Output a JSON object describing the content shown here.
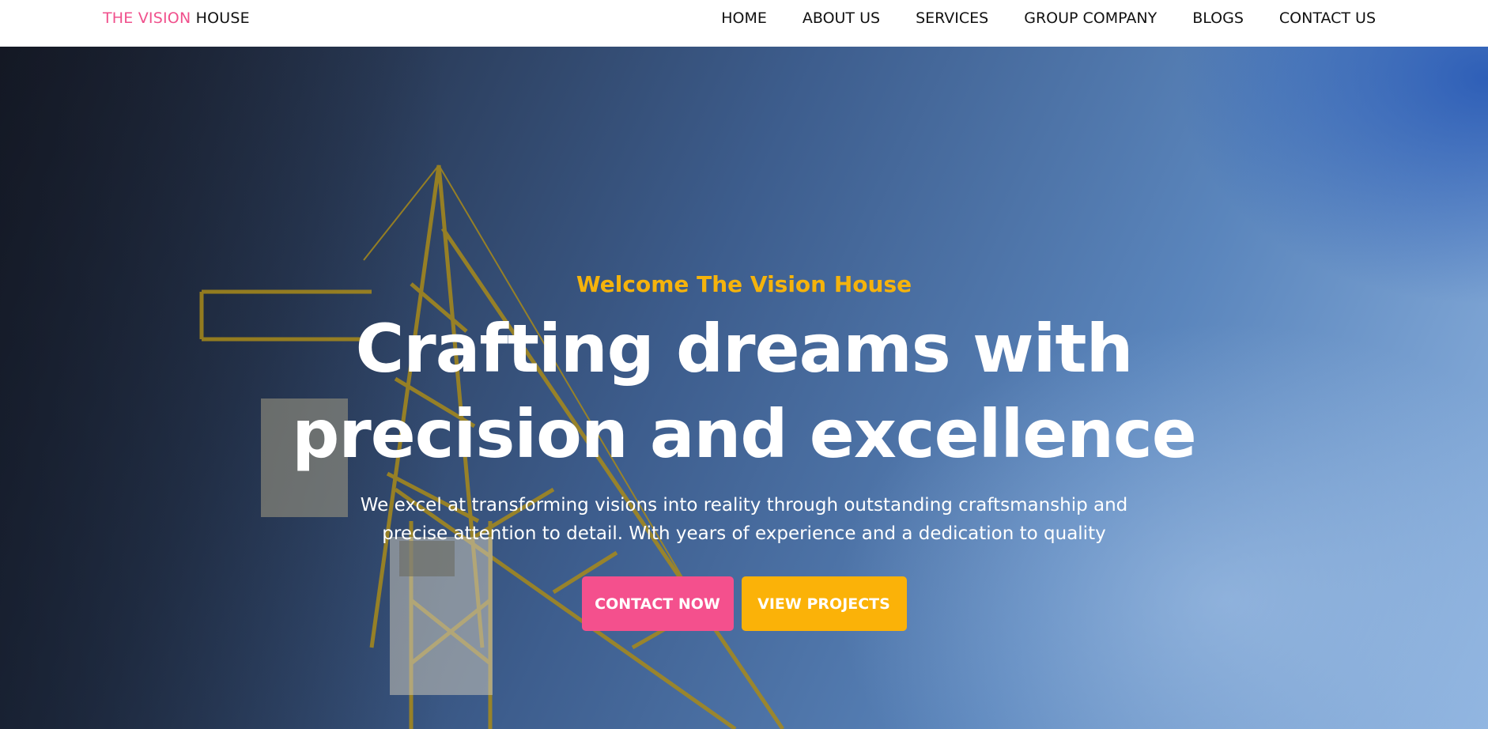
{
  "brand": {
    "accent_text": "THE VISION",
    "text": "HOUSE",
    "accent_color": "#f0508c"
  },
  "nav": {
    "items": [
      {
        "label": "HOME"
      },
      {
        "label": "ABOUT US"
      },
      {
        "label": "SERVICES"
      },
      {
        "label": "GROUP COMPANY"
      },
      {
        "label": "BLOGS"
      },
      {
        "label": "CONTACT US"
      }
    ]
  },
  "hero": {
    "eyebrow": "Welcome The Vision House",
    "headline": "Crafting dreams with precision and excellence",
    "subtext": "We excel at transforming visions into reality through outstanding craftsmanship and precise attention to detail. With years of experience and a dedication to quality",
    "primary_button": "CONTACT NOW",
    "secondary_button": "VIEW PROJECTS",
    "background_image": "crane-image",
    "colors": {
      "eyebrow": "#f5b30c",
      "primary_button": "#f4508d",
      "secondary_button": "#fbb208"
    }
  }
}
